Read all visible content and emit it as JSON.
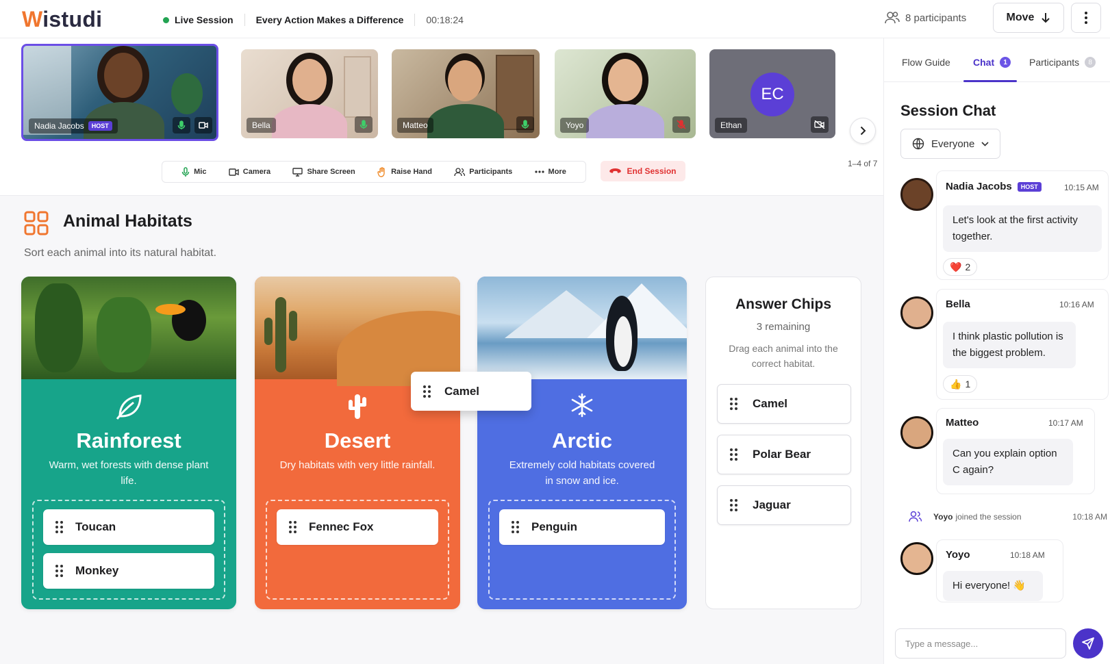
{
  "app": {
    "logo_prefix": "W",
    "logo_rest": "istudi"
  },
  "session": {
    "status": "Live Session",
    "title": "Every Action Makes a Difference",
    "elapsed": "00:18:24"
  },
  "header": {
    "participants_label": "8 participants",
    "move_label": "Move"
  },
  "videos": {
    "tiles": [
      {
        "name": "Nadia Jacobs",
        "badge": "HOST",
        "mic": "on",
        "camera": "on",
        "active": true
      },
      {
        "name": "Bella",
        "mic": "on"
      },
      {
        "name": "Matteo",
        "mic": "on"
      },
      {
        "name": "Yoyo",
        "mic": "muted"
      },
      {
        "name": "Ethan",
        "initials": "EC",
        "camera": "off"
      }
    ],
    "page_indicator": "1–4 of 7"
  },
  "controls": {
    "mic": "Mic",
    "camera": "Camera",
    "share": "Share Screen",
    "raise": "Raise Hand",
    "participants": "Participants",
    "more": "More",
    "end": "End Session"
  },
  "activity": {
    "title": "Animal Habitats",
    "subtitle": "Sort each animal into its natural habitat.",
    "habitats": [
      {
        "name": "Rainforest",
        "desc": "Warm, wet forests with dense plant life.",
        "color": "#17a48a",
        "chips": [
          "Toucan",
          "Monkey"
        ]
      },
      {
        "name": "Desert",
        "desc": "Dry habitats with very little rainfall.",
        "color": "#f26a3c",
        "chips": [
          "Fennec Fox"
        ]
      },
      {
        "name": "Arctic",
        "desc": "Extremely cold habitats covered in snow and ice.",
        "color": "#4f6ee2",
        "chips": [
          "Penguin"
        ]
      }
    ],
    "dragging_chip": "Camel",
    "answer_panel": {
      "title": "Answer Chips",
      "remaining": "3 remaining",
      "help": "Drag each animal into the correct habitat.",
      "chips": [
        "Camel",
        "Polar Bear",
        "Jaguar"
      ]
    }
  },
  "sidebar": {
    "tabs": [
      {
        "label": "Flow Guide"
      },
      {
        "label": "Chat",
        "count": "1",
        "active": true
      },
      {
        "label": "Participants",
        "count": "8"
      }
    ],
    "chat_title": "Session Chat",
    "audience": "Everyone",
    "messages": [
      {
        "author": "Nadia Jacobs",
        "badge": "HOST",
        "time": "10:15 AM",
        "text": "Let's look at the first activity together.",
        "reaction": "❤️",
        "reaction_count": "2"
      },
      {
        "author": "Bella",
        "time": "10:16 AM",
        "text": "I think plastic pollution is the biggest problem.",
        "reaction": "👍",
        "reaction_count": "1"
      },
      {
        "author": "Matteo",
        "time": "10:17 AM",
        "text": "Can you explain option C again?"
      },
      {
        "author": "Yoyo",
        "time": "10:18 AM",
        "text": "Hi everyone! 👋"
      }
    ],
    "system": {
      "name": "Yoyo",
      "text": "joined the session",
      "time": "10:18 AM"
    },
    "composer_placeholder": "Type a message..."
  }
}
